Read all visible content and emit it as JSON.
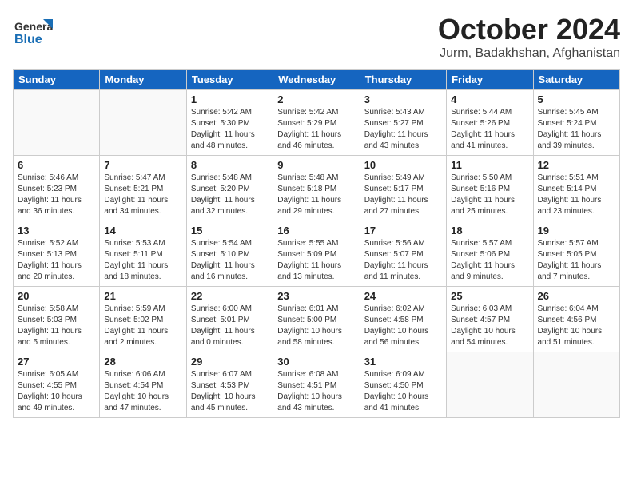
{
  "header": {
    "logo_line1": "General",
    "logo_line2": "Blue",
    "month": "October 2024",
    "location": "Jurm, Badakhshan, Afghanistan"
  },
  "weekdays": [
    "Sunday",
    "Monday",
    "Tuesday",
    "Wednesday",
    "Thursday",
    "Friday",
    "Saturday"
  ],
  "weeks": [
    [
      {
        "day": "",
        "detail": ""
      },
      {
        "day": "",
        "detail": ""
      },
      {
        "day": "1",
        "detail": "Sunrise: 5:42 AM\nSunset: 5:30 PM\nDaylight: 11 hours\nand 48 minutes."
      },
      {
        "day": "2",
        "detail": "Sunrise: 5:42 AM\nSunset: 5:29 PM\nDaylight: 11 hours\nand 46 minutes."
      },
      {
        "day": "3",
        "detail": "Sunrise: 5:43 AM\nSunset: 5:27 PM\nDaylight: 11 hours\nand 43 minutes."
      },
      {
        "day": "4",
        "detail": "Sunrise: 5:44 AM\nSunset: 5:26 PM\nDaylight: 11 hours\nand 41 minutes."
      },
      {
        "day": "5",
        "detail": "Sunrise: 5:45 AM\nSunset: 5:24 PM\nDaylight: 11 hours\nand 39 minutes."
      }
    ],
    [
      {
        "day": "6",
        "detail": "Sunrise: 5:46 AM\nSunset: 5:23 PM\nDaylight: 11 hours\nand 36 minutes."
      },
      {
        "day": "7",
        "detail": "Sunrise: 5:47 AM\nSunset: 5:21 PM\nDaylight: 11 hours\nand 34 minutes."
      },
      {
        "day": "8",
        "detail": "Sunrise: 5:48 AM\nSunset: 5:20 PM\nDaylight: 11 hours\nand 32 minutes."
      },
      {
        "day": "9",
        "detail": "Sunrise: 5:48 AM\nSunset: 5:18 PM\nDaylight: 11 hours\nand 29 minutes."
      },
      {
        "day": "10",
        "detail": "Sunrise: 5:49 AM\nSunset: 5:17 PM\nDaylight: 11 hours\nand 27 minutes."
      },
      {
        "day": "11",
        "detail": "Sunrise: 5:50 AM\nSunset: 5:16 PM\nDaylight: 11 hours\nand 25 minutes."
      },
      {
        "day": "12",
        "detail": "Sunrise: 5:51 AM\nSunset: 5:14 PM\nDaylight: 11 hours\nand 23 minutes."
      }
    ],
    [
      {
        "day": "13",
        "detail": "Sunrise: 5:52 AM\nSunset: 5:13 PM\nDaylight: 11 hours\nand 20 minutes."
      },
      {
        "day": "14",
        "detail": "Sunrise: 5:53 AM\nSunset: 5:11 PM\nDaylight: 11 hours\nand 18 minutes."
      },
      {
        "day": "15",
        "detail": "Sunrise: 5:54 AM\nSunset: 5:10 PM\nDaylight: 11 hours\nand 16 minutes."
      },
      {
        "day": "16",
        "detail": "Sunrise: 5:55 AM\nSunset: 5:09 PM\nDaylight: 11 hours\nand 13 minutes."
      },
      {
        "day": "17",
        "detail": "Sunrise: 5:56 AM\nSunset: 5:07 PM\nDaylight: 11 hours\nand 11 minutes."
      },
      {
        "day": "18",
        "detail": "Sunrise: 5:57 AM\nSunset: 5:06 PM\nDaylight: 11 hours\nand 9 minutes."
      },
      {
        "day": "19",
        "detail": "Sunrise: 5:57 AM\nSunset: 5:05 PM\nDaylight: 11 hours\nand 7 minutes."
      }
    ],
    [
      {
        "day": "20",
        "detail": "Sunrise: 5:58 AM\nSunset: 5:03 PM\nDaylight: 11 hours\nand 5 minutes."
      },
      {
        "day": "21",
        "detail": "Sunrise: 5:59 AM\nSunset: 5:02 PM\nDaylight: 11 hours\nand 2 minutes."
      },
      {
        "day": "22",
        "detail": "Sunrise: 6:00 AM\nSunset: 5:01 PM\nDaylight: 11 hours\nand 0 minutes."
      },
      {
        "day": "23",
        "detail": "Sunrise: 6:01 AM\nSunset: 5:00 PM\nDaylight: 10 hours\nand 58 minutes."
      },
      {
        "day": "24",
        "detail": "Sunrise: 6:02 AM\nSunset: 4:58 PM\nDaylight: 10 hours\nand 56 minutes."
      },
      {
        "day": "25",
        "detail": "Sunrise: 6:03 AM\nSunset: 4:57 PM\nDaylight: 10 hours\nand 54 minutes."
      },
      {
        "day": "26",
        "detail": "Sunrise: 6:04 AM\nSunset: 4:56 PM\nDaylight: 10 hours\nand 51 minutes."
      }
    ],
    [
      {
        "day": "27",
        "detail": "Sunrise: 6:05 AM\nSunset: 4:55 PM\nDaylight: 10 hours\nand 49 minutes."
      },
      {
        "day": "28",
        "detail": "Sunrise: 6:06 AM\nSunset: 4:54 PM\nDaylight: 10 hours\nand 47 minutes."
      },
      {
        "day": "29",
        "detail": "Sunrise: 6:07 AM\nSunset: 4:53 PM\nDaylight: 10 hours\nand 45 minutes."
      },
      {
        "day": "30",
        "detail": "Sunrise: 6:08 AM\nSunset: 4:51 PM\nDaylight: 10 hours\nand 43 minutes."
      },
      {
        "day": "31",
        "detail": "Sunrise: 6:09 AM\nSunset: 4:50 PM\nDaylight: 10 hours\nand 41 minutes."
      },
      {
        "day": "",
        "detail": ""
      },
      {
        "day": "",
        "detail": ""
      }
    ]
  ]
}
